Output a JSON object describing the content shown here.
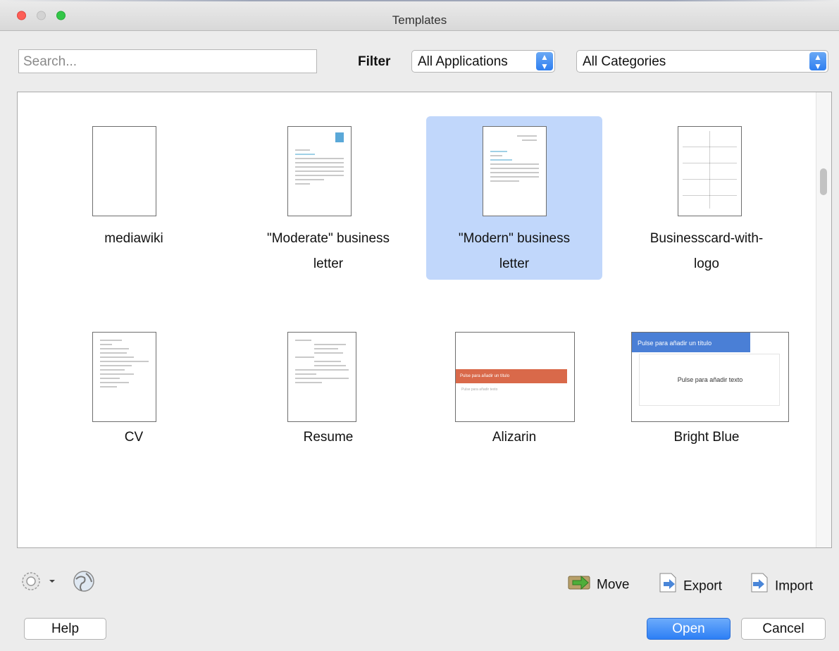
{
  "window": {
    "title": "Templates"
  },
  "toolbar": {
    "search_placeholder": "Search...",
    "filter_label": "Filter",
    "applications_selected": "All Applications",
    "categories_selected": "All Categories"
  },
  "templates": [
    {
      "name": "mediawiki",
      "line1": "mediawiki",
      "line2": ""
    },
    {
      "name": "\"Moderate\" business letter",
      "line1": "\"Moderate\" business",
      "line2": "letter"
    },
    {
      "name": "\"Modern\" business letter",
      "line1": "\"Modern\" business",
      "line2": "letter",
      "selected": true
    },
    {
      "name": "Businesscard-with-logo",
      "line1": "Businesscard-with-",
      "line2": "logo"
    },
    {
      "name": "CV",
      "line1": "CV",
      "line2": ""
    },
    {
      "name": "Resume",
      "line1": "Resume",
      "line2": ""
    },
    {
      "name": "Alizarin",
      "line1": "Alizarin",
      "line2": "",
      "preview_title": "Pulse para añadir un título",
      "preview_text": "Pulse para añadir texto"
    },
    {
      "name": "Bright Blue",
      "line1": "Bright Blue",
      "line2": "",
      "preview_title": "Pulse para añadir un título",
      "preview_text": "Pulse para añadir texto"
    }
  ],
  "actions": {
    "move": "Move",
    "export": "Export",
    "import": "Import"
  },
  "buttons": {
    "help": "Help",
    "open": "Open",
    "cancel": "Cancel"
  },
  "colors": {
    "selection": "#c1d7fb",
    "accent": "#2d7ff5",
    "alizarin": "#d9694a",
    "bright_blue": "#4a7fd6"
  },
  "icons": {
    "settings": "gear-icon",
    "online": "globe-icon",
    "move": "move-folder-icon",
    "export": "export-icon",
    "import": "import-icon"
  }
}
